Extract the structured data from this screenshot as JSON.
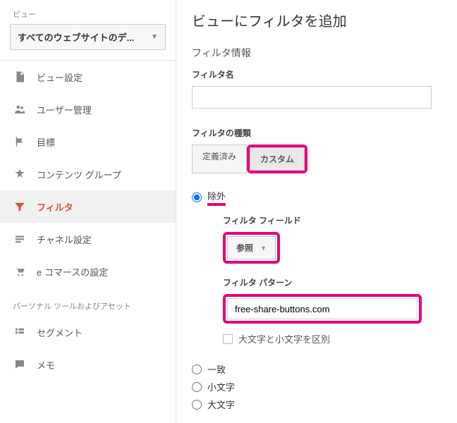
{
  "sidebar": {
    "label": "ビュー",
    "select_value": "すべてのウェブサイトのデ...",
    "items": [
      {
        "label": "ビュー設定"
      },
      {
        "label": "ユーザー管理"
      },
      {
        "label": "目標"
      },
      {
        "label": "コンテンツ グループ"
      },
      {
        "label": "フィルタ"
      },
      {
        "label": "チャネル設定"
      },
      {
        "label": "e コマースの設定"
      }
    ],
    "sub_label": "パーソナル ツールおよびアセット",
    "sub_items": [
      {
        "label": "セグメント"
      },
      {
        "label": "メモ"
      }
    ]
  },
  "main": {
    "title": "ビューにフィルタを追加",
    "info_label": "フィルタ情報",
    "name_label": "フィルタ名",
    "name_value": "",
    "type_label": "フィルタの種類",
    "type_predef": "定義済み",
    "type_custom": "カスタム",
    "radio_exclude": "除外",
    "field_label": "フィルタ フィールド",
    "field_value": "参照",
    "pattern_label": "フィルタ パターン",
    "pattern_value": "free-share-buttons.com",
    "case_label": "大文字と小文字を区別",
    "radio_match": "一致",
    "radio_lower": "小文字",
    "radio_upper": "大文字"
  }
}
